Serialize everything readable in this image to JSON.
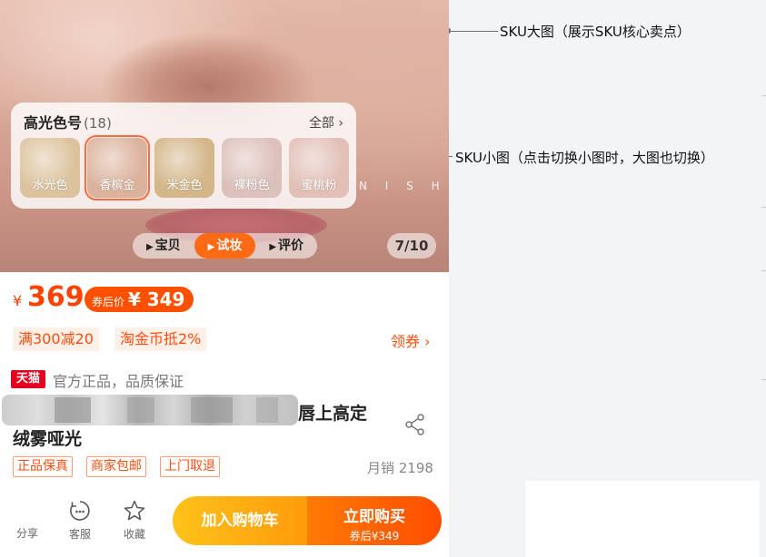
{
  "annotations": {
    "main_image": "SKU大图（展示SKU核心卖点）",
    "thumbnails": "SKU小图（点击切换小图时，大图也切换）"
  },
  "hero": {
    "brand_faint": "N I S H",
    "sku_panel": {
      "title": "高光色号",
      "count": "(18)",
      "all_label": "全部",
      "swatches": [
        {
          "label": "水光色",
          "color": "#dcc39e"
        },
        {
          "label": "香槟金",
          "color": "#dbb39d",
          "selected": true
        },
        {
          "label": "米金色",
          "color": "#d3b68a"
        },
        {
          "label": "裸粉色",
          "color": "#dcc0bb"
        },
        {
          "label": "蜜桃粉",
          "color": "#e2bfb7"
        }
      ]
    },
    "segments": [
      "宝贝",
      "试妆",
      "评价"
    ],
    "active_segment": "试妆",
    "counter": "7/10"
  },
  "price": {
    "currency": "¥",
    "value": "369",
    "coupon_prefix": "券后价",
    "coupon_value": "¥ 349"
  },
  "promotions": [
    "满300减20",
    "淘金币抵2%"
  ],
  "get_coupon": "领券",
  "badge": {
    "tmall": "天猫",
    "official": "官方正品，品质保证"
  },
  "title": {
    "line1_visible": "唇上高定",
    "line2": "绒雾哑光"
  },
  "tags": [
    "正品保真",
    "商家包邮",
    "上门取退"
  ],
  "sales": "月销 2198",
  "bottom_bar": {
    "share": "分享",
    "service": "客服",
    "favorite": "收藏",
    "add_to_cart": "加入购物车",
    "buy_now": "立即购买",
    "buy_sub": "券后¥349"
  },
  "colors": {
    "accent": "#ff5000",
    "cart": "#ffa90f",
    "tmall": "#e5001f"
  }
}
